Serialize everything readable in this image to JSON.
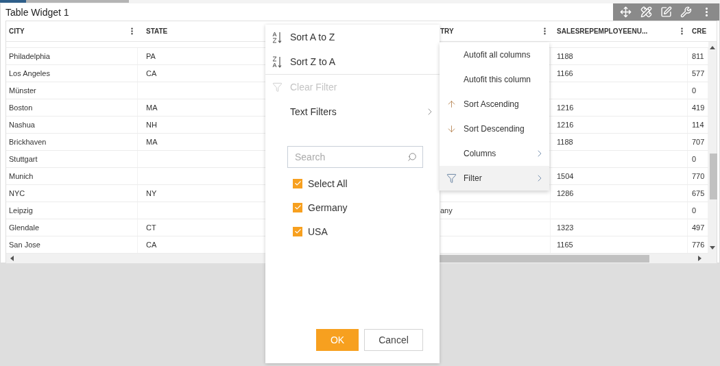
{
  "widget": {
    "title": "Table Widget 1"
  },
  "table": {
    "columns": [
      {
        "label": "CITY",
        "menu_button": true
      },
      {
        "label": "STATE",
        "menu_button": false
      },
      {
        "label": "TRY",
        "menu_button": true
      },
      {
        "label": "SALESREPEMPLOYEENU...",
        "menu_button": true
      },
      {
        "label": "CRE",
        "menu_button": false
      }
    ],
    "rows": [
      [
        "Philadelphia",
        "PA",
        null,
        "1188",
        "811"
      ],
      [
        "Los Angeles",
        "CA",
        null,
        "1166",
        "577"
      ],
      [
        "Münster",
        null,
        null,
        null,
        "0"
      ],
      [
        "Boston",
        "MA",
        null,
        "1216",
        "419"
      ],
      [
        "Nashua",
        "NH",
        null,
        "1216",
        "114"
      ],
      [
        "Brickhaven",
        "MA",
        null,
        "1188",
        "707"
      ],
      [
        "Stuttgart",
        null,
        null,
        null,
        "0"
      ],
      [
        "Munich",
        null,
        null,
        "1504",
        "770"
      ],
      [
        "NYC",
        "NY",
        null,
        "1286",
        "675"
      ],
      [
        "Leipzig",
        null,
        "any",
        null,
        "0"
      ],
      [
        "Glendale",
        "CT",
        null,
        "1323",
        "497"
      ],
      [
        "San Jose",
        "CA",
        null,
        "1165",
        "776"
      ]
    ]
  },
  "filter_menu": {
    "items": [
      {
        "kind": "sort_az",
        "label": "Sort A to Z",
        "disabled": false
      },
      {
        "kind": "sort_za",
        "label": "Sort Z to A",
        "disabled": false
      },
      {
        "kind": "clear_filter",
        "label": "Clear Filter",
        "disabled": true
      },
      {
        "kind": "submenu",
        "label": "Text Filters",
        "disabled": false
      }
    ],
    "search": {
      "placeholder": "Search"
    },
    "options": [
      {
        "label": "Select All",
        "checked": true
      },
      {
        "label": "Germany",
        "checked": true
      },
      {
        "label": "USA",
        "checked": true
      }
    ],
    "buttons": [
      {
        "kind": "primary",
        "label": "OK"
      },
      {
        "kind": "secondary",
        "label": "Cancel"
      }
    ]
  },
  "column_menu": {
    "items": [
      {
        "kind": "plain",
        "label": "Autofit all columns",
        "selected": false
      },
      {
        "kind": "plain",
        "label": "Autofit this column",
        "selected": false
      },
      {
        "kind": "sort_asc",
        "label": "Sort Ascending",
        "selected": false
      },
      {
        "kind": "sort_desc",
        "label": "Sort Descending",
        "selected": false
      },
      {
        "kind": "submenu",
        "label": "Columns",
        "selected": false
      },
      {
        "kind": "filter",
        "label": "Filter",
        "selected": true
      }
    ]
  }
}
